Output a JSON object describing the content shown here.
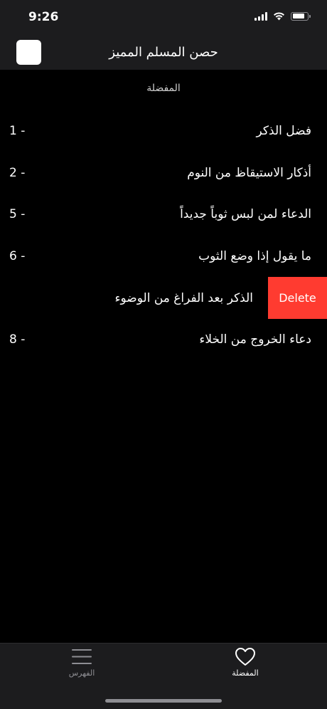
{
  "status_bar": {
    "time": "9:26"
  },
  "nav": {
    "title": "حصن المسلم المميز"
  },
  "section": {
    "title": "المفضلة"
  },
  "rows": [
    {
      "label": "فضل الذكر",
      "number": "1 -"
    },
    {
      "label": "أذكار الاستيقاظ من النوم",
      "number": "2 -"
    },
    {
      "label": "الدعاء لمن لبس ثوباً جديداً",
      "number": "5 -"
    },
    {
      "label": "ما يقول إذا وضع الثوب",
      "number": "6 -"
    },
    {
      "label": "الذكر بعد الفراغ من الوضوء",
      "delete_label": "Delete"
    },
    {
      "label": "دعاء الخروج من الخلاء",
      "number": "8 -"
    }
  ],
  "tabs": {
    "favorites": {
      "label": "المفضلة",
      "icon": "heart-icon"
    },
    "index": {
      "label": "الفهرس",
      "icon": "menu-icon"
    }
  },
  "colors": {
    "background": "#000000",
    "bars": "#1c1c1e",
    "delete": "#ff3b30"
  }
}
